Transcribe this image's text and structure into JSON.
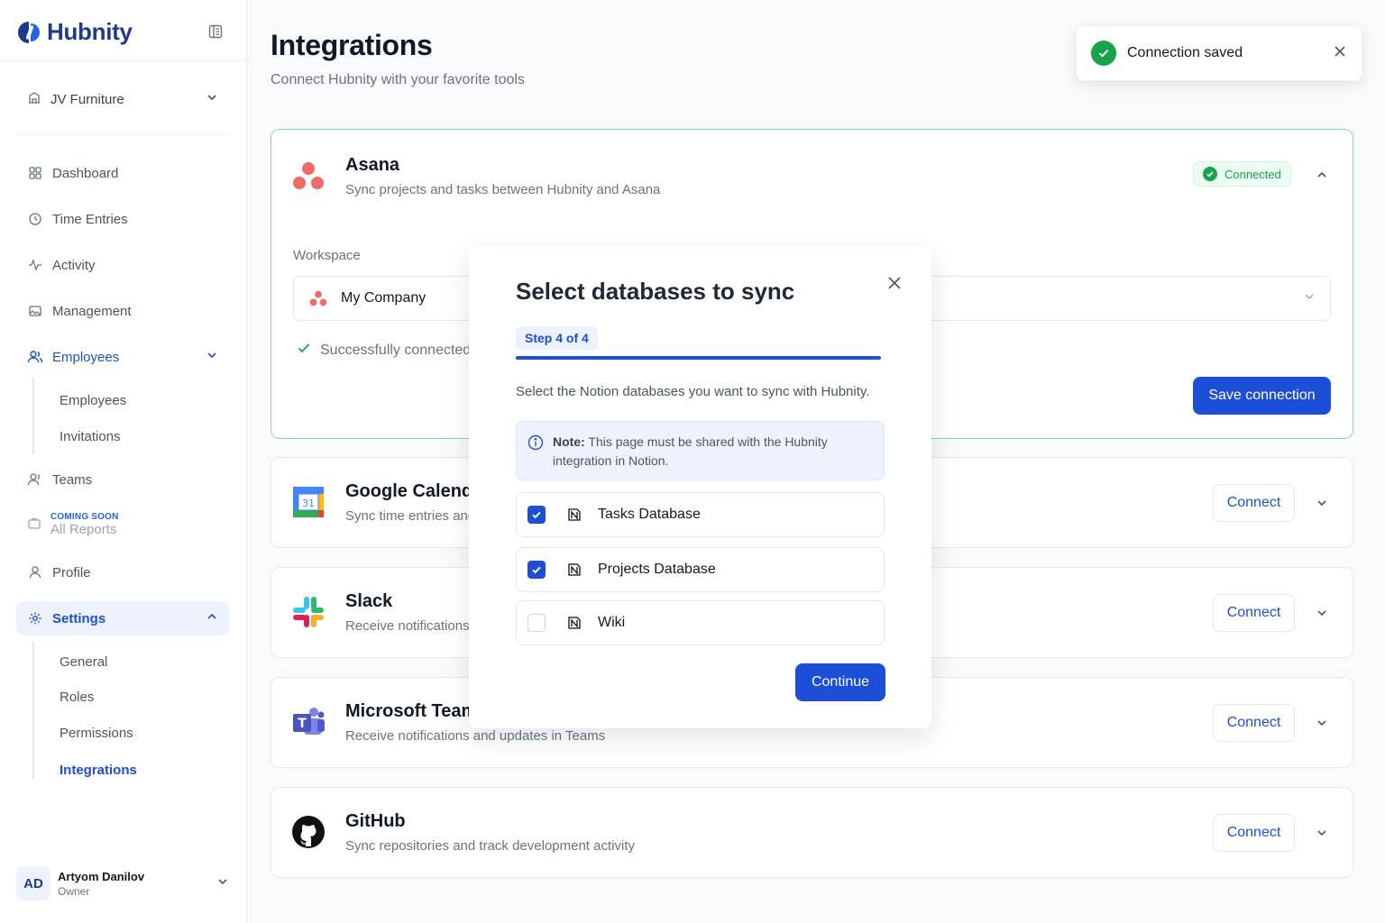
{
  "brand": {
    "name": "Hubnity"
  },
  "sidebar": {
    "workspace": "JV Furniture",
    "nav": [
      {
        "label": "Dashboard"
      },
      {
        "label": "Time Entries"
      },
      {
        "label": "Activity"
      },
      {
        "label": "Management"
      },
      {
        "label": "Employees"
      },
      {
        "label": "Teams"
      },
      {
        "label": "Profile"
      },
      {
        "label": "Settings"
      }
    ],
    "employees_sub": [
      "Employees",
      "Invitations"
    ],
    "coming_soon": {
      "tag": "COMING SOON",
      "label": "All Reports"
    },
    "settings_sub": [
      "General",
      "Roles",
      "Permissions",
      "Integrations"
    ],
    "user": {
      "initials": "AD",
      "name": "Artyom Danilov",
      "role": "Owner"
    }
  },
  "page": {
    "title": "Integrations",
    "subtitle": "Connect Hubnity with your favorite tools"
  },
  "toast": {
    "message": "Connection saved"
  },
  "asana": {
    "title": "Asana",
    "desc": "Sync projects and tasks between Hubnity and Asana",
    "badge": "Connected",
    "workspace_label": "Workspace",
    "workspace_value": "My Company",
    "success": "Successfully connected",
    "save": "Save connection"
  },
  "integrations": [
    {
      "title": "Google Calendar",
      "desc": "Sync time entries and events with Google Calendar",
      "action": "Connect"
    },
    {
      "title": "Slack",
      "desc": "Receive notifications and updates in Slack",
      "action": "Connect"
    },
    {
      "title": "Microsoft Teams",
      "desc": "Receive notifications and updates in Teams",
      "action": "Connect"
    },
    {
      "title": "GitHub",
      "desc": "Sync repositories and track development activity",
      "action": "Connect"
    }
  ],
  "modal": {
    "title": "Select databases to sync",
    "step": "Step 4 of 4",
    "progress": 1.0,
    "desc": "Select the Notion databases you want to sync with Hubnity.",
    "note_bold": "Note:",
    "note_text": " This page must be shared with the Hubnity integration in Notion.",
    "databases": [
      {
        "name": "Tasks Database",
        "checked": true
      },
      {
        "name": "Projects Database",
        "checked": true
      },
      {
        "name": "Wiki",
        "checked": false
      }
    ],
    "continue": "Continue"
  },
  "colors": {
    "accent": "#1d4ed8",
    "success": "#16a34a",
    "brand": "#1e3a8a"
  }
}
